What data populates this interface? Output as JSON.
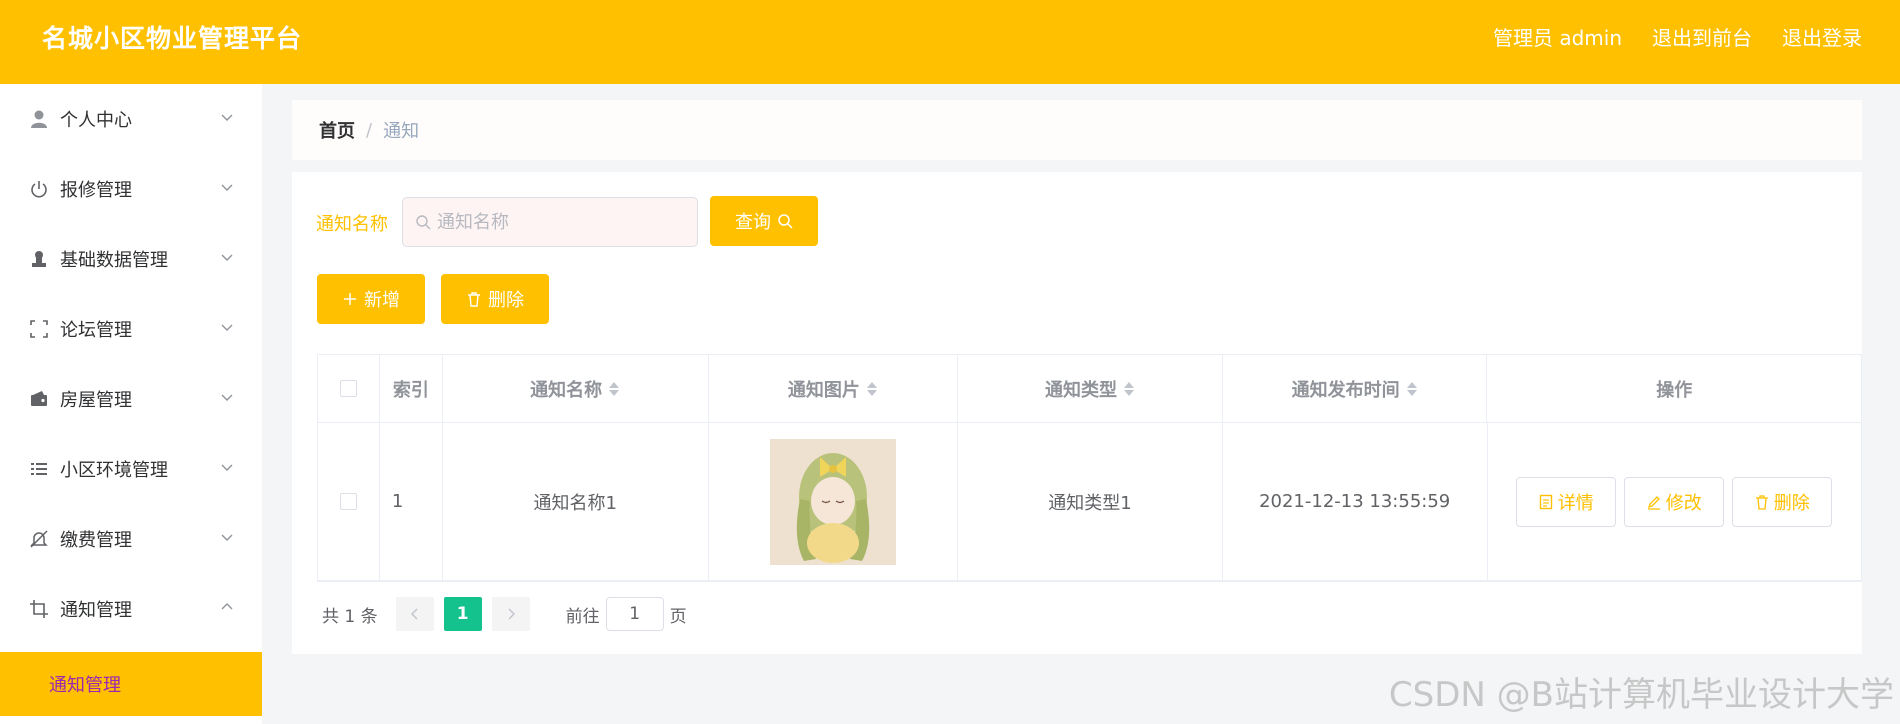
{
  "header": {
    "title": "名城小区物业管理平台",
    "admin_label": "管理员 admin",
    "to_front": "退出到前台",
    "logout": "退出登录"
  },
  "sidebar": {
    "items": [
      {
        "label": "个人中心",
        "icon": "user-icon"
      },
      {
        "label": "报修管理",
        "icon": "power-icon"
      },
      {
        "label": "基础数据管理",
        "icon": "stamp-icon"
      },
      {
        "label": "论坛管理",
        "icon": "frame-icon"
      },
      {
        "label": "房屋管理",
        "icon": "wallet-icon"
      },
      {
        "label": "小区环境管理",
        "icon": "list-icon"
      },
      {
        "label": "缴费管理",
        "icon": "bell-off-icon"
      },
      {
        "label": "通知管理",
        "icon": "crop-icon"
      }
    ],
    "active_sub": "通知管理"
  },
  "breadcrumb": {
    "home": "首页",
    "separator": "/",
    "current": "通知"
  },
  "search": {
    "label": "通知名称",
    "placeholder": "通知名称",
    "query_label": "查询"
  },
  "actions": {
    "add_label": "新增",
    "delete_label": "删除"
  },
  "table": {
    "headers": {
      "index": "索引",
      "name": "通知名称",
      "image": "通知图片",
      "type": "通知类型",
      "time": "通知发布时间",
      "ops": "操作"
    },
    "rows": [
      {
        "index": "1",
        "name": "通知名称1",
        "type": "通知类型1",
        "time": "2021-12-13 13:55:59"
      }
    ],
    "row_buttons": {
      "detail": "详情",
      "edit": "修改",
      "delete": "删除"
    }
  },
  "pagination": {
    "total": "共 1 条",
    "current": "1",
    "goto": "前往",
    "page_value": "1",
    "page_suffix": "页"
  },
  "watermark": "CSDN @B站计算机毕业设计大学",
  "colors": {
    "accent": "#ffc000",
    "active_sub_text": "#9c27b0",
    "pager_active": "#13c28d"
  }
}
